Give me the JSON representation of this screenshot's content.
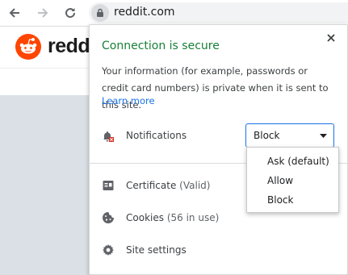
{
  "toolbar": {
    "url": "reddit.com"
  },
  "site": {
    "brand": "reddit",
    "brand_color": "#ff4500"
  },
  "popup": {
    "title": "Connection is secure",
    "description": "Your information (for example, passwords or credit card numbers) is private when it is sent to this site.",
    "learn_more": "Learn more",
    "notifications": {
      "label": "Notifications",
      "selected": "Block",
      "options": [
        "Ask (default)",
        "Allow",
        "Block"
      ]
    },
    "certificate": {
      "label": "Certificate",
      "status": "(Valid)"
    },
    "cookies": {
      "label": "Cookies",
      "status": "(56 in use)"
    },
    "site_settings": {
      "label": "Site settings"
    }
  },
  "colors": {
    "secure_green": "#188038",
    "link_blue": "#1a73e8",
    "page_bg": "#dae0e6"
  }
}
